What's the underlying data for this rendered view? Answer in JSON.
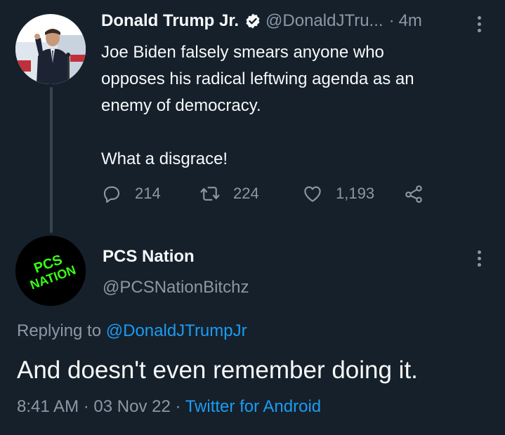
{
  "parent_tweet": {
    "author_name": "Donald Trump Jr.",
    "handle": "@DonaldJTru...",
    "separator": "·",
    "time": "4m",
    "text": "Joe Biden falsely smears anyone who\nopposes his radical leftwing agenda as an\nenemy of democracy.\n\nWhat a disgrace!",
    "replies": "214",
    "retweets": "224",
    "likes": "1,193",
    "icons": [
      "verified-icon",
      "reply-icon",
      "retweet-icon",
      "like-icon",
      "share-icon",
      "more-icon"
    ]
  },
  "reply_tweet": {
    "author_name": "PCS Nation",
    "handle": "@PCSNationBitchz",
    "avatar_text_line1": "PCS",
    "avatar_text_line2": "NATION",
    "replying_prefix": "Replying to",
    "replying_to": "@DonaldJTrumpJr",
    "text": "And doesn't even remember doing it.",
    "time": "8:41 AM",
    "date": "03 Nov 22",
    "separator": "·",
    "source": "Twitter for Android"
  },
  "colors": {
    "background": "#15202b",
    "primary_text": "#f7f9f9",
    "secondary_text": "#8b98a5",
    "accent": "#1d9bf0",
    "avatar_text": "#39ff14"
  }
}
